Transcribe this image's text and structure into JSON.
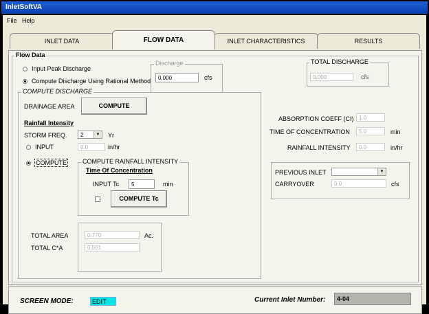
{
  "window": {
    "title": "InletSoftVA"
  },
  "menu": [
    "File",
    "Help"
  ],
  "tabs": [
    "INLET DATA",
    "FLOW DATA",
    "INLET CHARACTERISTICS",
    "RESULTS"
  ],
  "active_tab": "FLOW DATA",
  "flow_data": {
    "title": "Flow Data",
    "option_peak": "Input Peak Discharge",
    "option_rational": "Compute Discharge Using Rational Method",
    "selected_option": "Compute Discharge Using Rational Method",
    "discharge": {
      "label": "Discharge",
      "value": "0.000",
      "unit": "cfs"
    },
    "total_discharge": {
      "label": "TOTAL DISCHARGE",
      "value": "0.000",
      "unit": "cfs"
    }
  },
  "compute_discharge": {
    "title": "COMPUTE DISCHARGE",
    "drainage_area_label": "DRAINAGE AREA",
    "compute_button": "COMPUTE",
    "rainfall_intensity_title": "Rainfall Intensity",
    "storm_freq_label": "STORM FREQ.",
    "storm_freq_value": "2",
    "storm_freq_unit": "Yr",
    "input_label": "INPUT",
    "input_value": "0.0",
    "input_unit": "in/hr",
    "compute_label": "COMPUTE",
    "selected_intensity_option": "COMPUTE",
    "compute_rainfall": {
      "title": "COMPUTE RAINFALL INTENSITY",
      "toc_title": "Time Of Concentration",
      "input_tc_label": "INPUT Tc",
      "input_tc_value": "5",
      "input_tc_unit": "min",
      "compute_tc_button": "COMPUTE Tc"
    },
    "total_area_label": "TOTAL AREA",
    "total_area_value": "0.770",
    "total_area_unit": "Ac.",
    "total_ca_label": "TOTAL C*A",
    "total_ca_value": "0.501"
  },
  "right": {
    "absorption_label": "ABSORPTION COEFF (CI)",
    "absorption_value": "1.0",
    "toc_label": "TIME OF CONCENTRATION",
    "toc_value": "5.0",
    "toc_unit": "min",
    "rainfall_label": "RAINFALL INTENSITY",
    "rainfall_value": "0.0",
    "rainfall_unit": "in/hr",
    "previous_inlet_label": "PREVIOUS INLET",
    "previous_inlet_value": "",
    "carryover_label": "CARRYOVER",
    "carryover_value": "0.0",
    "carryover_unit": "cfs"
  },
  "status": {
    "screen_mode_label": "SCREEN MODE:",
    "screen_mode_value": "EDIT",
    "current_inlet_label": "Current Inlet Number:",
    "current_inlet_value": "4-04"
  }
}
